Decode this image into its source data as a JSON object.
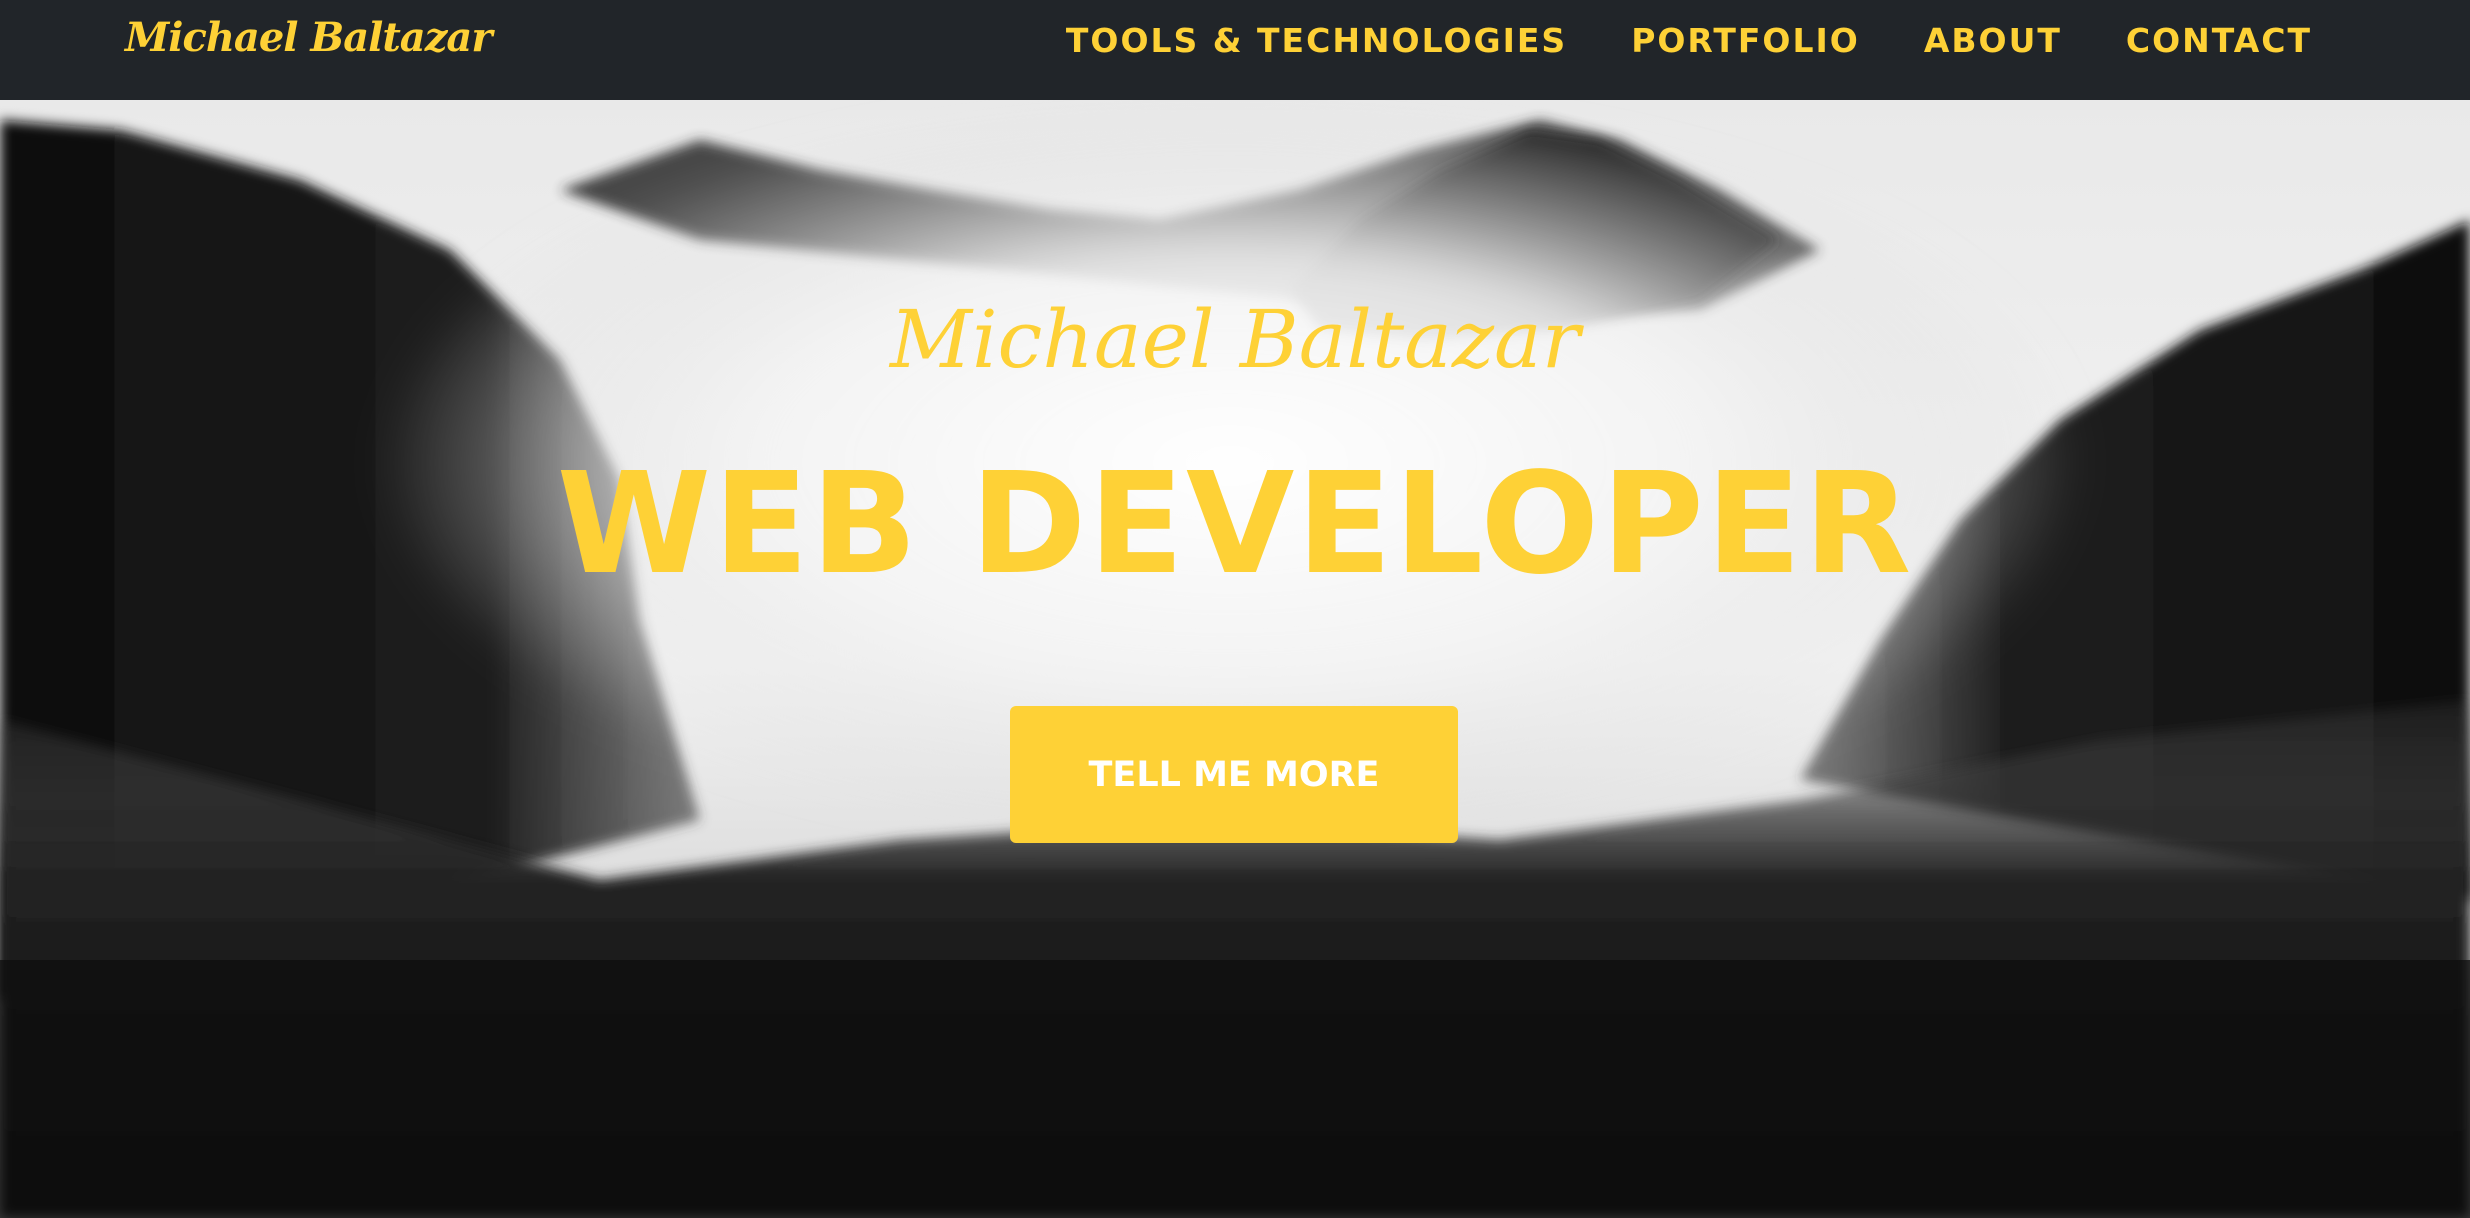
{
  "navbar": {
    "brand": "Michael Baltazar",
    "links": [
      {
        "label": "TOOLS & TECHNOLOGIES"
      },
      {
        "label": "PORTFOLIO"
      },
      {
        "label": "ABOUT"
      },
      {
        "label": "CONTACT"
      }
    ]
  },
  "hero": {
    "subheading": "Michael Baltazar",
    "heading": "WEB DEVELOPER",
    "button_label": "TELL ME MORE",
    "background_image": "misty-forest-mountains-photo"
  },
  "colors": {
    "accent": "#fed136",
    "navbar_bg": "#212529",
    "button_text": "#ffffff"
  }
}
